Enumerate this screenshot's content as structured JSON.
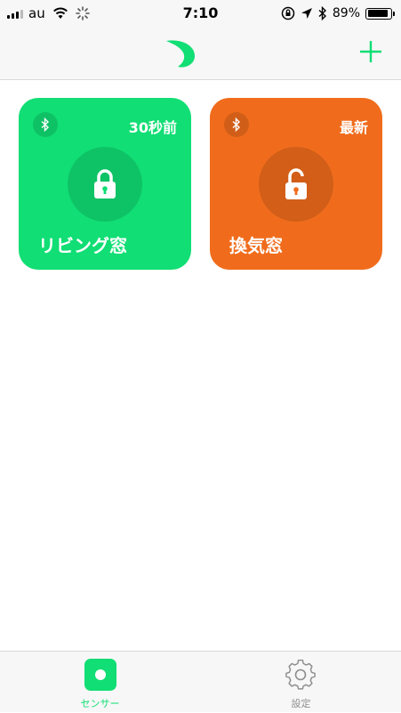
{
  "status_bar": {
    "carrier": "au",
    "time": "7:10",
    "battery_percent": "89%",
    "battery_level": 0.89,
    "icons": [
      "signal-icon",
      "wifi-icon",
      "activity-spinner-icon",
      "orientation-lock-icon",
      "location-icon",
      "bluetooth-icon",
      "battery-icon"
    ]
  },
  "navbar": {
    "logo_icon": "leaf-logo-icon",
    "add_icon": "plus-icon"
  },
  "sensors": [
    {
      "name": "リビング窓",
      "updated": "30秒前",
      "state": "locked",
      "color": "#11de74",
      "lock_icon": "lock-closed-icon"
    },
    {
      "name": "換気窓",
      "updated": "最新",
      "state": "unlocked",
      "color": "#f06c1c",
      "lock_icon": "lock-open-icon"
    }
  ],
  "tabbar": {
    "tabs": [
      {
        "label": "センサー",
        "icon": "sensor-icon",
        "active": true
      },
      {
        "label": "設定",
        "icon": "gear-icon",
        "active": false
      }
    ]
  },
  "colors": {
    "accent": "#11de74",
    "orange": "#f06c1c"
  }
}
